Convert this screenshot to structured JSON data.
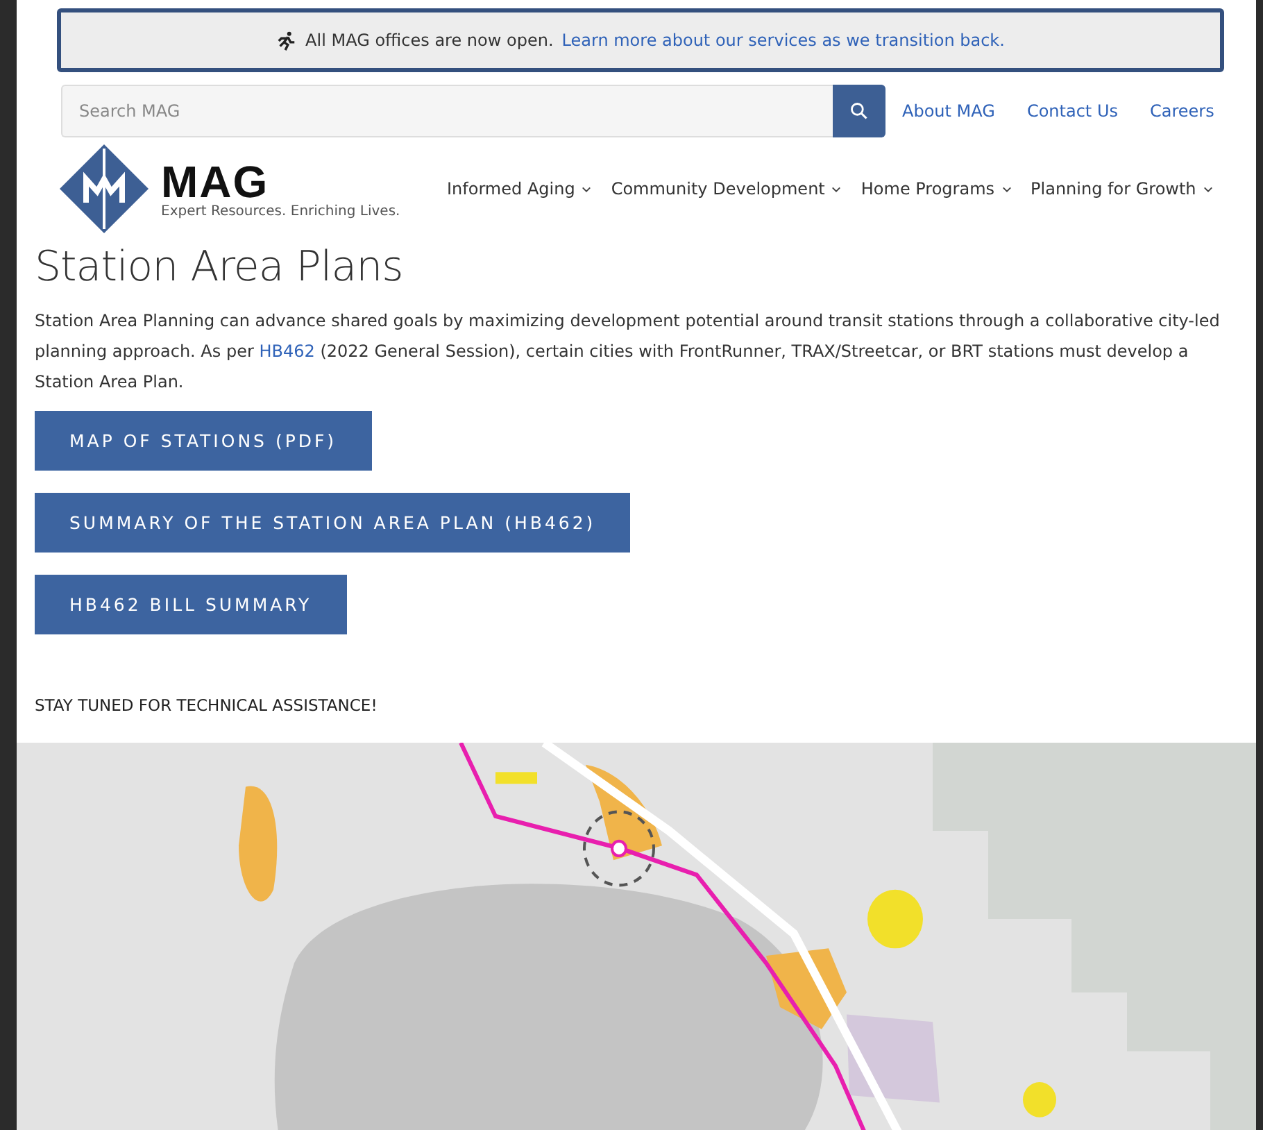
{
  "alert": {
    "text": "All MAG offices are now open.",
    "link": "Learn more about our services as we transition back."
  },
  "search": {
    "placeholder": "Search MAG"
  },
  "top_links": [
    "About MAG",
    "Contact Us",
    "Careers"
  ],
  "logo": {
    "name": "MAG",
    "tagline": "Expert Resources. Enriching Lives."
  },
  "nav": [
    "Informed Aging",
    "Community Development",
    "Home Programs",
    "Planning for Growth"
  ],
  "page": {
    "title": "Station Area Plans",
    "intro": "Station Area Planning can advance shared goals by maximizing development potential around transit stations through a collaborative city-led planning approach. As per ",
    "intro_link": "HB462",
    "intro_end": " (2022 General Session), certain cities with FrontRunner, TRAX/Streetcar, or BRT stations must develop a Station Area Plan.",
    "buttons": [
      "MAP OF STATIONS (PDF)",
      "SUMMARY OF THE STATION AREA PLAN (HB462)",
      "HB462 BILL SUMMARY"
    ],
    "notice": "STAY TUNED FOR TECHNICAL ASSISTANCE!"
  },
  "map": {
    "kind": "picture"
  }
}
